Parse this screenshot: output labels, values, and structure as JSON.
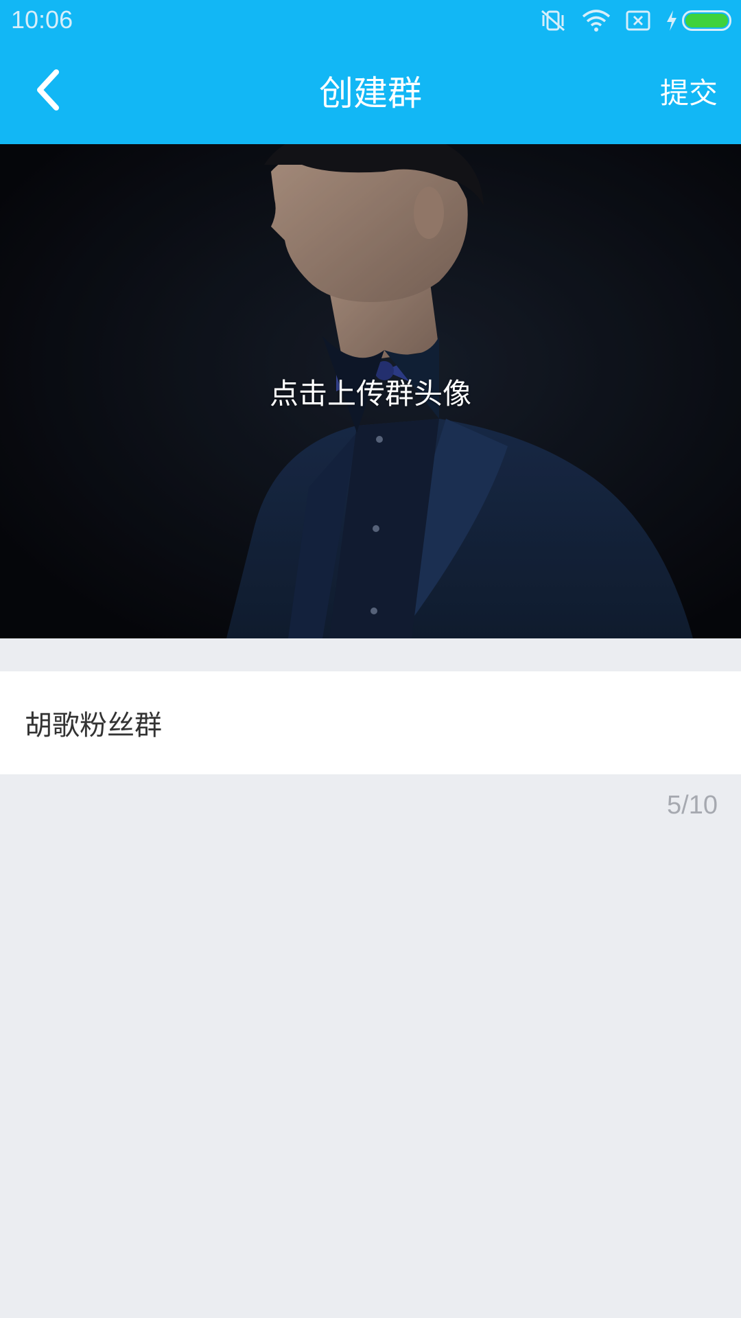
{
  "status_bar": {
    "time": "10:06",
    "icons": [
      "vibrate-off-icon",
      "wifi-icon",
      "no-sim-icon",
      "charging-icon",
      "battery-icon"
    ],
    "battery_color": "#3fd23c"
  },
  "nav": {
    "title": "创建群",
    "submit_label": "提交",
    "back_icon": "chevron-left-icon",
    "background_color": "#12b7f5"
  },
  "avatar": {
    "upload_hint": "点击上传群头像"
  },
  "group_name": {
    "value": "胡歌粉丝群",
    "counter": "5/10"
  }
}
